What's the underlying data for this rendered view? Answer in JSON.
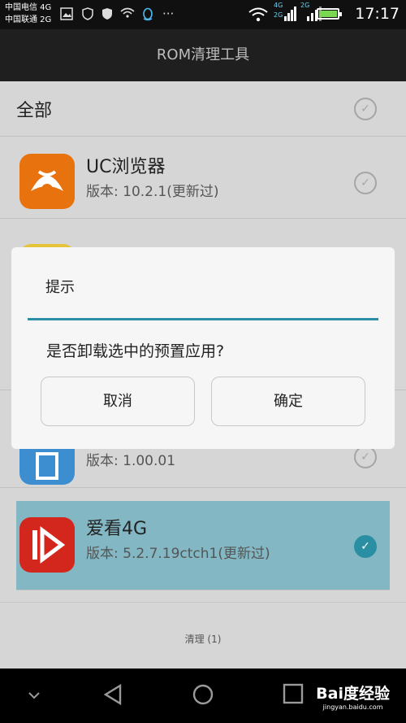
{
  "status_bar": {
    "carrier1": "中国电信 4G",
    "carrier2": "中国联通 2G",
    "net_top_left": "4G",
    "net_bottom_left": "2G",
    "net_top_right": "2G",
    "time": "17:17",
    "more_icon": "···"
  },
  "app_bar": {
    "title": "ROM清理工具"
  },
  "list": {
    "select_all_label": "全部",
    "apps": [
      {
        "name": "UC浏览器",
        "version": "版本: 10.2.1(更新过)",
        "checked": false
      },
      {
        "name": "",
        "version": "版本: 1.00.01",
        "checked": false
      },
      {
        "name": "爱看4G",
        "version": "版本: 5.2.7.19ctch1(更新过)",
        "checked": true
      }
    ],
    "action_label": "清理 (1)"
  },
  "dialog": {
    "title": "提示",
    "message": "是否卸载选中的预置应用?",
    "cancel_label": "取消",
    "confirm_label": "确定"
  },
  "watermark": {
    "brand": "Bai度经验",
    "url": "jingyan.baidu.com"
  },
  "colors": {
    "accent": "#2b8fa3",
    "selected_row": "#82b7c3"
  }
}
